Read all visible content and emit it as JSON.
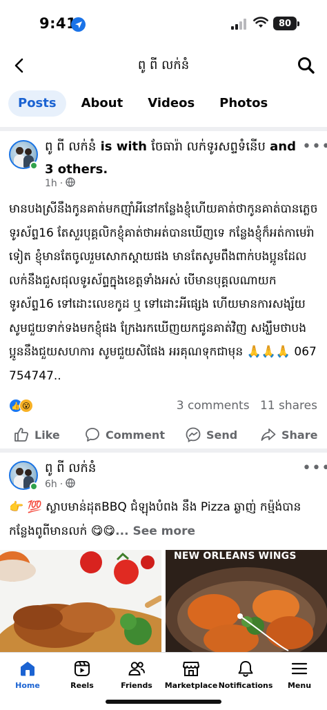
{
  "status_bar": {
    "time": "9:41",
    "battery": "80"
  },
  "header": {
    "title": "ពូ ពី លក់នំ"
  },
  "tabs": [
    {
      "label": "Posts",
      "active": true
    },
    {
      "label": "About",
      "active": false
    },
    {
      "label": "Videos",
      "active": false
    },
    {
      "label": "Photos",
      "active": false
    }
  ],
  "posts": [
    {
      "author": "ពូ ពី លក់នំ",
      "with_text": " is with ",
      "with_name": "ចែធារ៉ា លក់ទូរសព្ទទំនើប",
      "and_text": " and 3 others.",
      "time": "1h",
      "body": "មានបងស្រីនឹងកូនគាត់មកញ៉ាំអីនៅកន្លែងខ្ញុំហើយគាត់ថាកូនគាត់បានភ្លេចទូរស័ព្ទ16 តែសួរបុគ្គលិកខ្ញុំគាត់ថាអត់បានឃើញទេ កន្លែងខ្ញុំក៏អត់កាមេរ៉ាទៀត ខ្ញុំមានតែចូលរួមសោកស្តាយផង មានតែសូមពឹងពាក់បងប្អូនដែលលក់នឹងជួសជុលទូរស័ព្ទក្នុងខេត្តទាំងអស់ បើមានបុគ្គលណាយកទូរស័ព្ទ16 ទៅដោះលេខកូដ ឬ ទៅដោះអីផ្សេង ហើយមានការសង្ស័យ សូមជួយទាក់ទងមកខ្ញុំផង ក្រែងរកឃើញយកជូនគាត់វិញ សង្ឃឹមថាបងប្អូននឹងជួយសហការ សូមជួយសិផែង អរគុណទុកជាមុន 🙏🙏🙏 067 754747..",
      "comments": "3 comments",
      "shares": "11 shares",
      "actions": {
        "like": "Like",
        "comment": "Comment",
        "send": "Send",
        "share": "Share"
      }
    },
    {
      "author": "ពូ ពី លក់នំ",
      "time": "6h",
      "body": "👉 💯 ស្លាបមាន់ដុតBBQ ជំឡុងបំពង នឹង Pizza ឆ្ងាញ់ កម៉្ម៉ង់បាន កន្លែងពូពីមានលក់ 😋😋",
      "see_more": "... See more",
      "photo_caption": "NEW ORLEANS WINGS"
    }
  ],
  "bottom_nav": [
    {
      "label": "Home",
      "icon": "home-icon",
      "active": true
    },
    {
      "label": "Reels",
      "icon": "reels-icon",
      "active": false
    },
    {
      "label": "Friends",
      "icon": "friends-icon",
      "active": false
    },
    {
      "label": "Marketplace",
      "icon": "marketplace-icon",
      "active": false
    },
    {
      "label": "Notifications",
      "icon": "bell-icon",
      "active": false
    },
    {
      "label": "Menu",
      "icon": "menu-icon",
      "active": false
    }
  ],
  "colors": {
    "accent": "#1b63d2",
    "tab_active_bg": "#e7f0fb",
    "online": "#31a24c"
  }
}
